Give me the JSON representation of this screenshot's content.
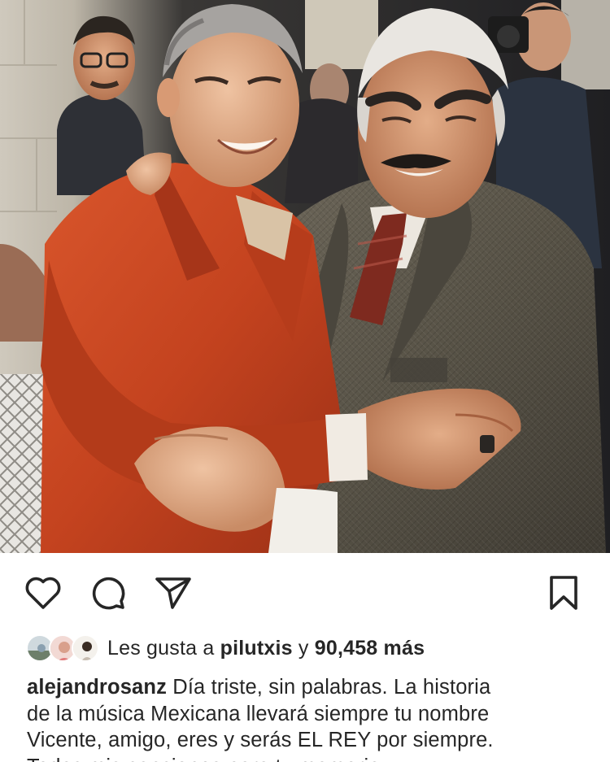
{
  "post": {
    "photo_alt": "",
    "actions": {
      "like_icon": "heart-icon",
      "comment_icon": "comment-bubble-icon",
      "share_icon": "paper-plane-icon",
      "save_icon": "bookmark-icon"
    },
    "likes": {
      "prefix": "Les gusta a ",
      "user": "pilutxis",
      "middle": " y ",
      "count": "90,458 más"
    },
    "caption": {
      "username": "alejandrosanz",
      "line1": " Día triste, sin palabras. La historia",
      "line2": "de la música Mexicana llevará siempre tu nombre",
      "line3": "Vicente, amigo, eres y serás EL REY por siempre.",
      "line4": "Todas mis canciones para tu memoria"
    }
  },
  "colors": {
    "text": "#262626",
    "icon": "#262626",
    "background": "#ffffff",
    "jacket_red": "#c4431f",
    "suit_gray": "#5b5548"
  }
}
